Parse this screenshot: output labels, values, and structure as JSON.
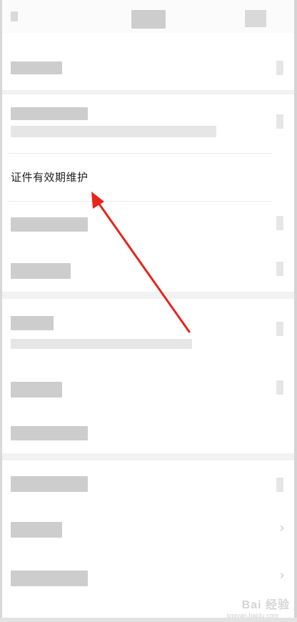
{
  "list": {
    "highlighted_item_label": "证件有效期维护"
  },
  "icons": {
    "chevron": "›"
  },
  "annotation": {
    "arrow_color": "#e8231b"
  },
  "watermark": {
    "brand": "Bai 经验",
    "site": "jingyan.baidu.com"
  }
}
